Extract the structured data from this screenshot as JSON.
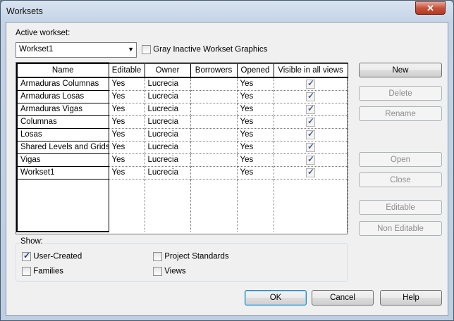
{
  "window": {
    "title": "Worksets",
    "close_glyph": "✕"
  },
  "active_workset": {
    "label": "Active workset:",
    "value": "Workset1",
    "arrow": "▼"
  },
  "gray_inactive": {
    "label": "Gray Inactive Workset Graphics",
    "checked": false
  },
  "table": {
    "columns": [
      "Name",
      "Editable",
      "Owner",
      "Borrowers",
      "Opened",
      "Visible in all views"
    ],
    "rows": [
      {
        "name": "Armaduras Columnas",
        "editable": "Yes",
        "owner": "Lucrecia",
        "borrowers": "",
        "opened": "Yes",
        "visible": true
      },
      {
        "name": "Armaduras Losas",
        "editable": "Yes",
        "owner": "Lucrecia",
        "borrowers": "",
        "opened": "Yes",
        "visible": true
      },
      {
        "name": "Armaduras Vigas",
        "editable": "Yes",
        "owner": "Lucrecia",
        "borrowers": "",
        "opened": "Yes",
        "visible": true
      },
      {
        "name": "Columnas",
        "editable": "Yes",
        "owner": "Lucrecia",
        "borrowers": "",
        "opened": "Yes",
        "visible": true
      },
      {
        "name": "Losas",
        "editable": "Yes",
        "owner": "Lucrecia",
        "borrowers": "",
        "opened": "Yes",
        "visible": true
      },
      {
        "name": "Shared Levels and Grids",
        "editable": "Yes",
        "owner": "Lucrecia",
        "borrowers": "",
        "opened": "Yes",
        "visible": true
      },
      {
        "name": "Vigas",
        "editable": "Yes",
        "owner": "Lucrecia",
        "borrowers": "",
        "opened": "Yes",
        "visible": true
      },
      {
        "name": "Workset1",
        "editable": "Yes",
        "owner": "Lucrecia",
        "borrowers": "",
        "opened": "Yes",
        "visible": true
      }
    ]
  },
  "side_buttons": {
    "new": "New",
    "delete": "Delete",
    "rename": "Rename",
    "open": "Open",
    "close": "Close",
    "editable": "Editable",
    "non_editable": "Non Editable"
  },
  "show": {
    "title": "Show:",
    "user_created": {
      "label": "User-Created",
      "checked": true
    },
    "families": {
      "label": "Families",
      "checked": false
    },
    "project_standards": {
      "label": "Project Standards",
      "checked": false
    },
    "views": {
      "label": "Views",
      "checked": false
    }
  },
  "footer": {
    "ok": "OK",
    "cancel": "Cancel",
    "help": "Help"
  }
}
